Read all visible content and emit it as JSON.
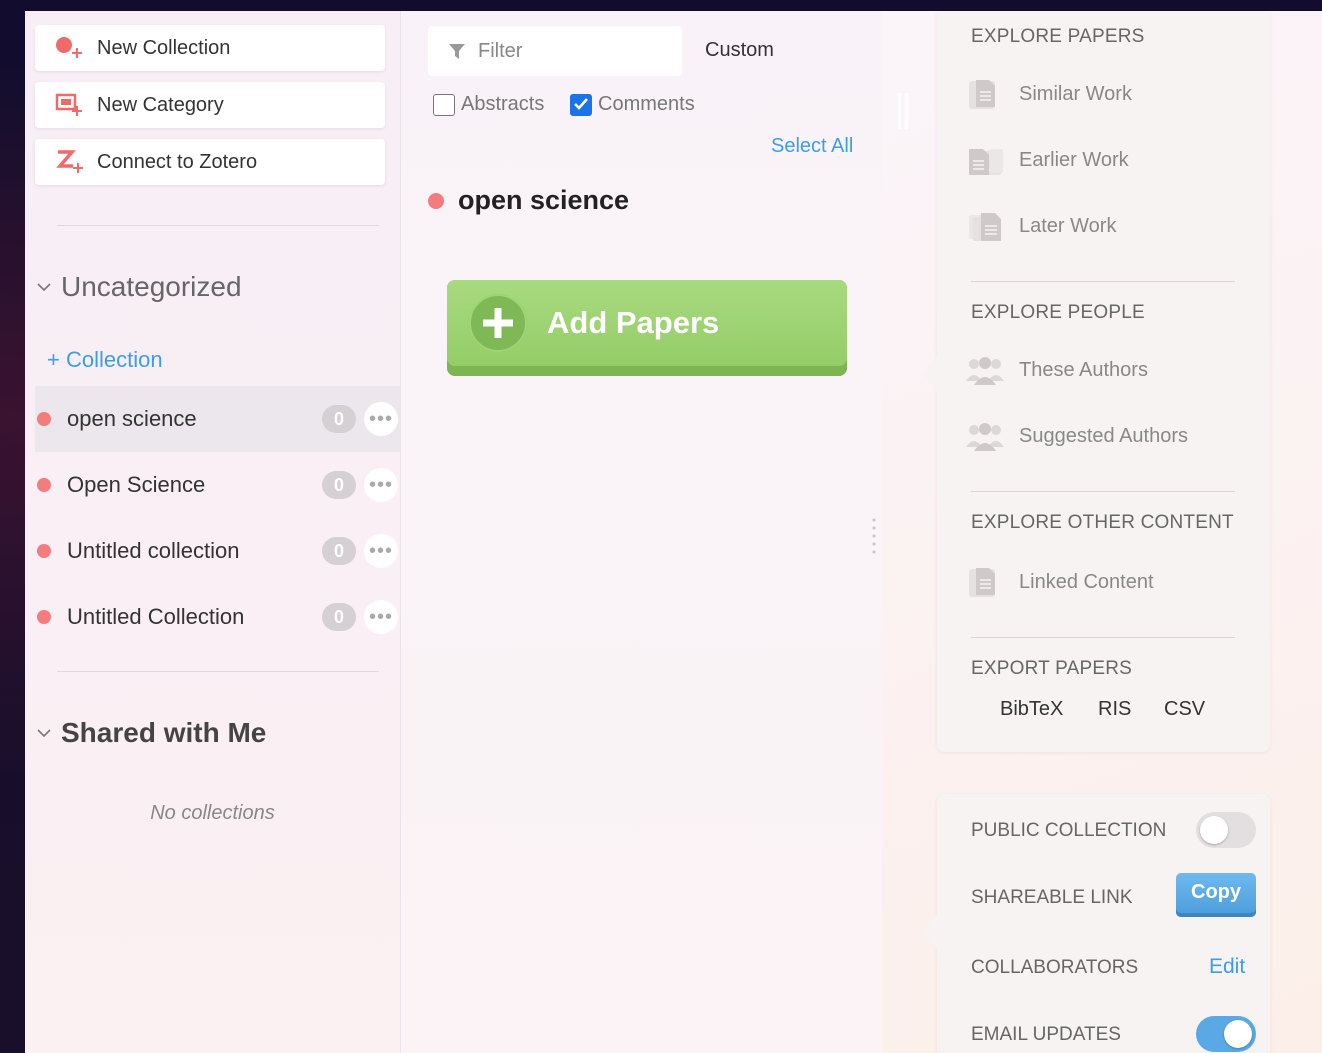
{
  "sidebar": {
    "actions": {
      "new_collection": "New Collection",
      "new_category": "New Category",
      "connect_zotero": "Connect to Zotero"
    },
    "uncategorized": {
      "title": "Uncategorized",
      "add_collection": "+ Collection",
      "collections": [
        {
          "name": "open science",
          "count": "0"
        },
        {
          "name": "Open Science",
          "count": "0"
        },
        {
          "name": "Untitled collection",
          "count": "0"
        },
        {
          "name": "Untitled Collection",
          "count": "0"
        }
      ]
    },
    "shared": {
      "title": "Shared with Me",
      "empty_text": "No collections"
    }
  },
  "middle": {
    "filter_placeholder": "Filter",
    "sort_label": "Custom",
    "abstracts_label": "Abstracts",
    "abstracts_checked": false,
    "comments_label": "Comments",
    "comments_checked": true,
    "select_all": "Select All",
    "current_collection": "open science",
    "add_papers": "Add Papers"
  },
  "explore": {
    "papers_title": "EXPLORE PAPERS",
    "similar_work": "Similar Work",
    "earlier_work": "Earlier Work",
    "later_work": "Later Work",
    "people_title": "EXPLORE PEOPLE",
    "these_authors": "These Authors",
    "suggested_authors": "Suggested Authors",
    "other_title": "EXPLORE OTHER CONTENT",
    "linked_content": "Linked Content",
    "export_title": "EXPORT PAPERS",
    "export_bibtex": "BibTeX",
    "export_ris": "RIS",
    "export_csv": "CSV"
  },
  "settings": {
    "public_collection": "PUBLIC COLLECTION",
    "public_on": false,
    "shareable_link": "SHAREABLE LINK",
    "copy": "Copy",
    "collaborators": "COLLABORATORS",
    "edit": "Edit",
    "email_updates": "EMAIL UPDATES",
    "email_on": true
  },
  "colors": {
    "accent_blue": "#3b9ee8",
    "collection_dot": "#f47c7c",
    "add_papers_green": "#94cd67",
    "icon_red": "#f06a6a"
  }
}
